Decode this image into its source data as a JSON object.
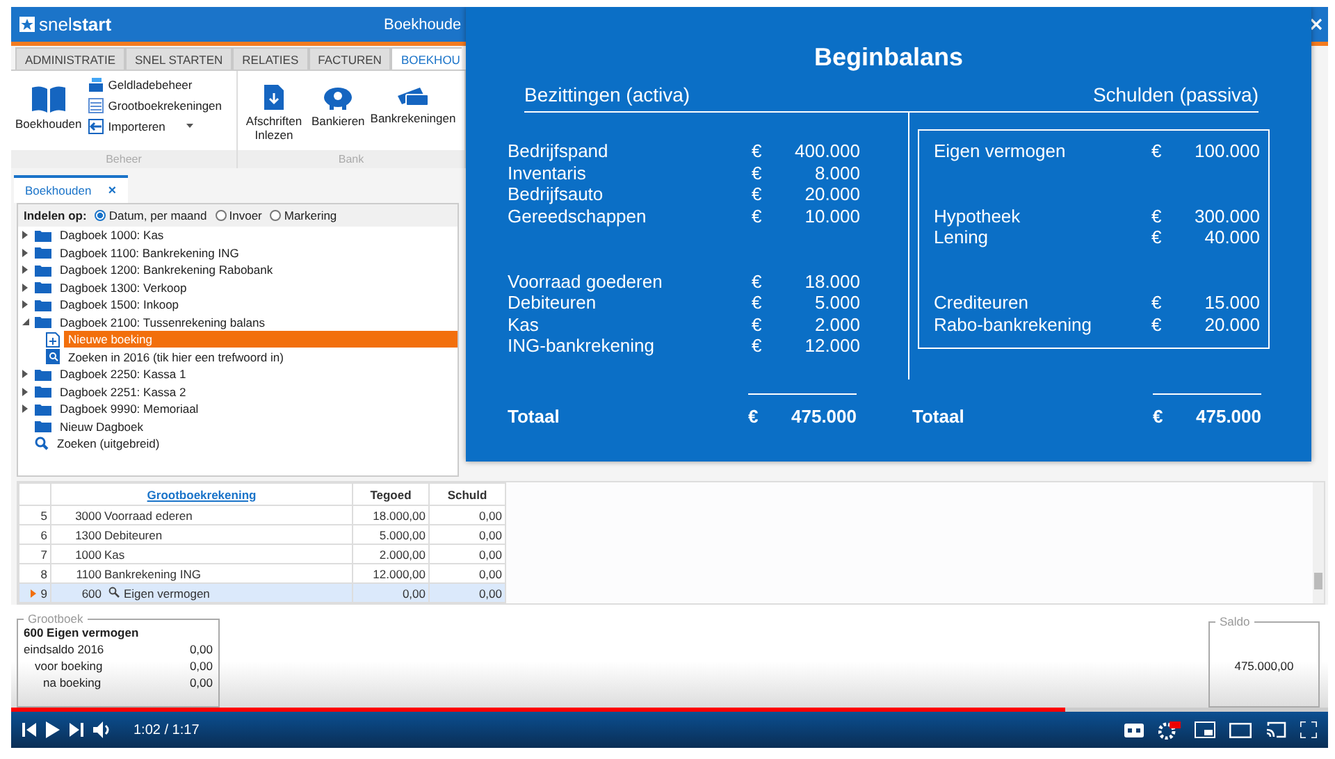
{
  "app": {
    "logo": "snel**start**",
    "title": "Boekhoude"
  },
  "ribbon": {
    "tabs": [
      {
        "label": "ADMINISTRATIE",
        "selected": false
      },
      {
        "label": "SNEL STARTEN",
        "selected": false
      },
      {
        "label": "RELATIES",
        "selected": false
      },
      {
        "label": "FACTUREN",
        "selected": false
      },
      {
        "label": "BOEKHOU",
        "selected": true
      }
    ],
    "groups": [
      {
        "label": "Beheer",
        "buttons": [
          {
            "kind": "large",
            "label": "Boekhouden"
          },
          {
            "kind": "small",
            "label": "Geldladebeheer"
          },
          {
            "kind": "small",
            "label": "Grootboekrekeningen"
          },
          {
            "kind": "dropdown",
            "label": "Importeren"
          }
        ]
      },
      {
        "label": "Bank",
        "buttons": [
          {
            "kind": "large",
            "label": "Afschriften Inlezen"
          },
          {
            "kind": "large",
            "label": "Bankieren"
          },
          {
            "kind": "large",
            "label": "Bankrekeningen"
          }
        ]
      }
    ]
  },
  "doc_tab": {
    "label": "Boekhouden",
    "close": "×"
  },
  "group_by": {
    "label": "Indelen op:",
    "options": [
      {
        "label": "Datum, per maand",
        "selected": true
      },
      {
        "label": "Invoer",
        "selected": false
      },
      {
        "label": "Markering",
        "selected": false
      }
    ]
  },
  "tree": {
    "items": [
      {
        "kind": "journal",
        "label": "Dagboek 1000: Kas",
        "expanded": false
      },
      {
        "kind": "journal",
        "label": "Dagboek 1100: Bankrekening ING",
        "expanded": false
      },
      {
        "kind": "journal",
        "label": "Dagboek 1200: Bankrekening Rabobank",
        "expanded": false
      },
      {
        "kind": "journal",
        "label": "Dagboek 1300: Verkoop",
        "expanded": false
      },
      {
        "kind": "journal",
        "label": "Dagboek 1500: Inkoop",
        "expanded": false
      },
      {
        "kind": "journal",
        "label": "Dagboek 2100: Tussenrekening balans",
        "expanded": true,
        "children": [
          {
            "kind": "new",
            "label": "Nieuwe boeking",
            "selected": true
          },
          {
            "kind": "search",
            "label": "Zoeken in 2016 (tik hier een trefwoord in)",
            "selected": false
          }
        ]
      },
      {
        "kind": "journal",
        "label": "Dagboek 2250: Kassa 1",
        "expanded": false
      },
      {
        "kind": "journal",
        "label": "Dagboek 2251: Kassa 2",
        "expanded": false
      },
      {
        "kind": "journal",
        "label": "Dagboek 9990: Memoriaal",
        "expanded": false
      },
      {
        "kind": "folder",
        "label": "Nieuw Dagboek"
      },
      {
        "kind": "find",
        "label": "Zoeken (uitgebreid)"
      }
    ]
  },
  "grid": {
    "columns": [
      "Grootboekrekening",
      "Tegoed",
      "Schuld"
    ],
    "rows": [
      {
        "number": "5",
        "code": "3000",
        "name": "Voorraad ederen",
        "credit": "18.000,00",
        "debit": "0,00",
        "current": false
      },
      {
        "number": "6",
        "code": "1300",
        "name": "Debiteuren",
        "credit": "5.000,00",
        "debit": "0,00",
        "current": false
      },
      {
        "number": "7",
        "code": "1000",
        "name": "Kas",
        "credit": "2.000,00",
        "debit": "0,00",
        "current": false
      },
      {
        "number": "8",
        "code": "1100",
        "name": "Bankrekening ING",
        "credit": "12.000,00",
        "debit": "0,00",
        "current": false
      },
      {
        "number": "9",
        "code": "600",
        "name": "Eigen vermogen",
        "credit": "0,00",
        "debit": "0,00",
        "current": true
      }
    ]
  },
  "ledger_box": {
    "title": "Grootboek",
    "heading": "600 Eigen vermogen",
    "lines": [
      {
        "label": "eindsaldo 2016",
        "value": "0,00"
      },
      {
        "label": "voor boeking",
        "value": "0,00"
      },
      {
        "label": "na boeking",
        "value": "0,00"
      }
    ]
  },
  "saldo_box": {
    "title": "Saldo",
    "value": "475.000,00"
  },
  "balance": {
    "title": "Beginbalans",
    "left": {
      "heading": "Bezittingen (activa)",
      "groups": [
        [
          {
            "name": "Bedrijfspand",
            "currency": "€",
            "amount": "400.000"
          },
          {
            "name": "Inventaris",
            "currency": "€",
            "amount": "8.000"
          },
          {
            "name": "Bedrijfsauto",
            "currency": "€",
            "amount": "20.000"
          },
          {
            "name": "Gereedschappen",
            "currency": "€",
            "amount": "10.000"
          }
        ],
        [
          {
            "name": "Voorraad goederen",
            "currency": "€",
            "amount": "18.000"
          },
          {
            "name": "Debiteuren",
            "currency": "€",
            "amount": "5.000"
          },
          {
            "name": "Kas",
            "currency": "€",
            "amount": "2.000"
          },
          {
            "name": "ING-bankrekening",
            "currency": "€",
            "amount": "12.000"
          }
        ]
      ],
      "total": {
        "label": "Totaal",
        "currency": "€",
        "amount": "475.000"
      }
    },
    "right": {
      "heading": "Schulden (passiva)",
      "groups": [
        [
          {
            "name": "Eigen vermogen",
            "currency": "€",
            "amount": "100.000"
          }
        ],
        [
          {
            "name": "Hypotheek",
            "currency": "€",
            "amount": "300.000"
          },
          {
            "name": "Lening",
            "currency": "€",
            "amount": "40.000"
          }
        ],
        [
          {
            "name": "Crediteuren",
            "currency": "€",
            "amount": "15.000"
          },
          {
            "name": "Rabo-bankrekening",
            "currency": "€",
            "amount": "20.000"
          }
        ]
      ],
      "total": {
        "label": "Totaal",
        "currency": "€",
        "amount": "475.000"
      }
    }
  },
  "player": {
    "time": "1:02 / 1:17",
    "progress": {
      "level": 0.8
    }
  }
}
